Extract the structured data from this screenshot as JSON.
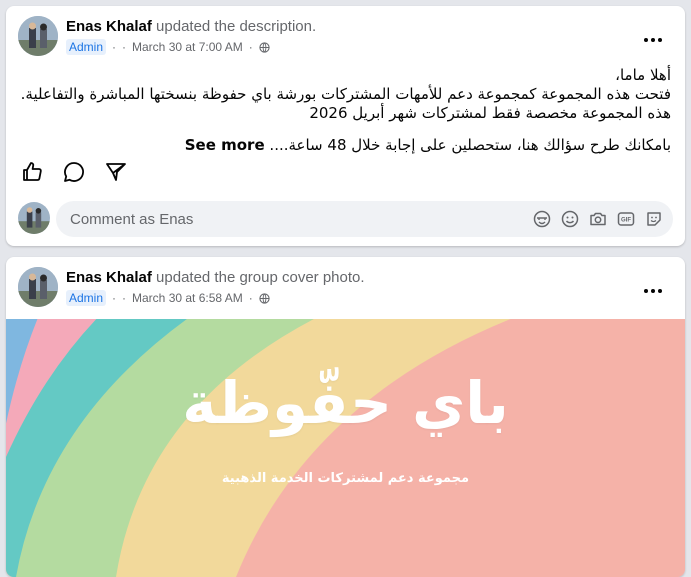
{
  "posts": [
    {
      "author": "Enas Khalaf",
      "action": "updated the description.",
      "badge": "Admin",
      "timestamp": "March 30 at 7:00 AM",
      "separator": "·",
      "privacy_icon": "globe-icon",
      "more_icon": "more-horizontal-icon",
      "text_lines": [
        "أهلا ماما،",
        "فتحت هذه المجموعة كمجموعة دعم للأمهات المشتركات بورشة باي حفوظة بنسختها المباشرة والتفاعلية. هذه المجموعة مخصصة فقط لمشتركات شهر أبريل 2026",
        "بامكانك  طرح سؤالك هنا، ستحصلين على إجابة خلال 48 ساعة...."
      ],
      "see_more": "See more",
      "actions": [
        "like-icon",
        "comment-icon",
        "share-icon"
      ],
      "comment_placeholder": "Comment as Enas",
      "comment_tools": [
        "avatar-sticker-icon",
        "emoji-icon",
        "camera-icon",
        "gif-icon",
        "sticker-icon"
      ]
    },
    {
      "author": "Enas Khalaf",
      "action": "updated the group cover photo.",
      "badge": "Admin",
      "timestamp": "March 30 at 6:58 AM",
      "separator": "·",
      "privacy_icon": "globe-icon",
      "more_icon": "more-horizontal-icon",
      "cover_title": "باي حفّوظة",
      "cover_subtitle": "مجموعة دعم لمشتركات الخدمة الذهبية"
    }
  ],
  "colors": {
    "accent": "#1b74e4",
    "secondary_text": "#65676b",
    "comment_bg": "#f0f2f5",
    "page_bg": "#e4e6eb",
    "cover_bands": [
      "#5cc8c4",
      "#a8d8a0",
      "#f2d89a",
      "#f5b6a6",
      "#f4a8b8"
    ]
  }
}
